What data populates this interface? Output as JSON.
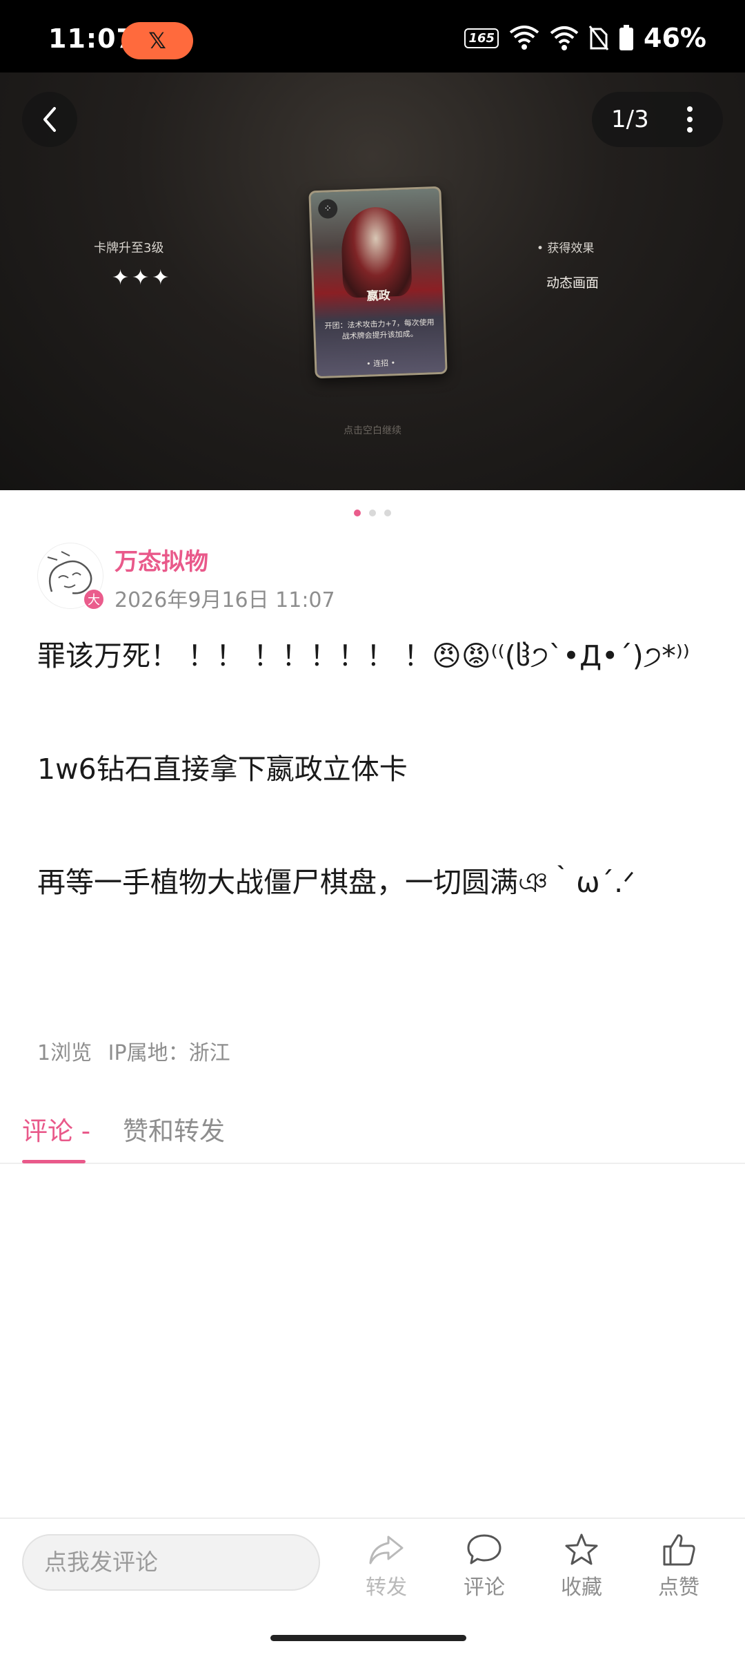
{
  "status_bar": {
    "time": "11:07",
    "pill_icon": "x-logo-icon",
    "refresh_badge": "165",
    "wifi_badge": "6",
    "battery": "46%"
  },
  "hero": {
    "counter": "1/3",
    "left_label": "卡牌升至3级",
    "left_stars": "✦✦✦",
    "right_label": "• 获得效果",
    "right_value": "动态画面",
    "hint": "点击空白继续",
    "card": {
      "name": "嬴政",
      "text": "开团：法术攻击力+7，每次使用战术牌会提升该加成。",
      "foot": "• 连招 •"
    },
    "page_count": 3,
    "page_active": 1
  },
  "author": {
    "name": "万态拟物",
    "time": "2026年9月16日 11:07",
    "badge": "大"
  },
  "post": {
    "line1": "罪该万死！ ！！ ！！！！！ ！😠😡⁽⁽(ჱ੭`•Д•´)੭*⁾⁾",
    "line2": "1w6钻石直接拿下嬴政立体卡",
    "line3": "再等一手植物大战僵尸棋盘，一切圆满ঞ｀ω´.ᐟ"
  },
  "meta": {
    "views": "1浏览",
    "ip": "IP属地：浙江"
  },
  "tabs": {
    "comments": "评论 -",
    "likes": "赞和转发"
  },
  "bottom_bar": {
    "input_placeholder": "点我发评论",
    "share": "转发",
    "comment": "评论",
    "favorite": "收藏",
    "like": "点赞"
  },
  "colors": {
    "accent": "#e9598a",
    "pill": "#ff6a3d"
  }
}
